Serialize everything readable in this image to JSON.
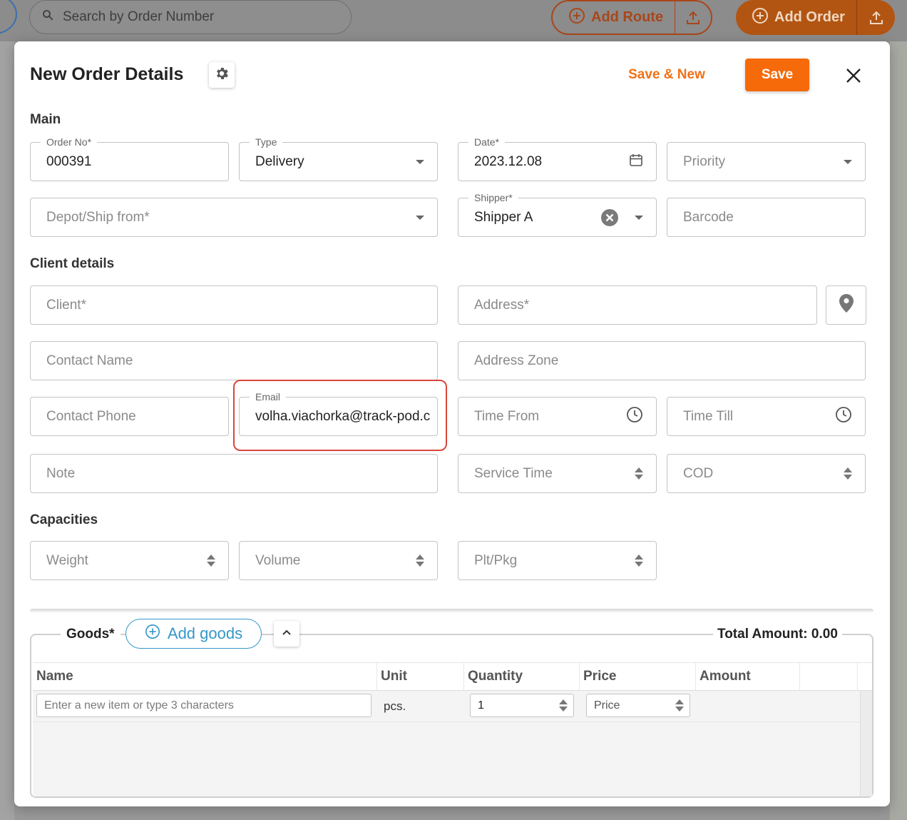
{
  "background": {
    "search_placeholder": "Search by Order Number",
    "add_route_label": "Add Route",
    "add_order_label": "Add Order"
  },
  "header": {
    "title": "New Order Details",
    "save_new_label": "Save & New",
    "save_label": "Save"
  },
  "sections": {
    "main": "Main",
    "client": "Client details",
    "capacities": "Capacities"
  },
  "main": {
    "order_no_label": "Order No*",
    "order_no_value": "000391",
    "type_label": "Type",
    "type_value": "Delivery",
    "date_label": "Date*",
    "date_value": "2023.12.08",
    "priority_placeholder": "Priority",
    "depot_placeholder": "Depot/Ship from*",
    "shipper_label": "Shipper*",
    "shipper_value": "Shipper A",
    "barcode_placeholder": "Barcode"
  },
  "client": {
    "client_placeholder": "Client*",
    "address_placeholder": "Address*",
    "contact_name_placeholder": "Contact Name",
    "address_zone_placeholder": "Address Zone",
    "contact_phone_placeholder": "Contact Phone",
    "email_label": "Email",
    "email_value": "volha.viachorka@track-pod.c",
    "time_from_placeholder": "Time From",
    "time_till_placeholder": "Time Till",
    "note_placeholder": "Note",
    "service_time_placeholder": "Service Time",
    "cod_placeholder": "COD"
  },
  "capacities": {
    "weight_placeholder": "Weight",
    "volume_placeholder": "Volume",
    "plt_placeholder": "Plt/Pkg"
  },
  "goods": {
    "label": "Goods*",
    "add_label": "Add goods",
    "total_label": "Total Amount: 0.00",
    "columns": [
      "Name",
      "Unit",
      "Quantity",
      "Price",
      "Amount"
    ],
    "row": {
      "name_placeholder": "Enter a new item or type 3 characters",
      "unit": "pcs.",
      "quantity": "1",
      "price_placeholder": "Price"
    }
  },
  "colors": {
    "accent": "#f66a0a",
    "link": "#3597c9",
    "highlight": "#d9473b"
  }
}
